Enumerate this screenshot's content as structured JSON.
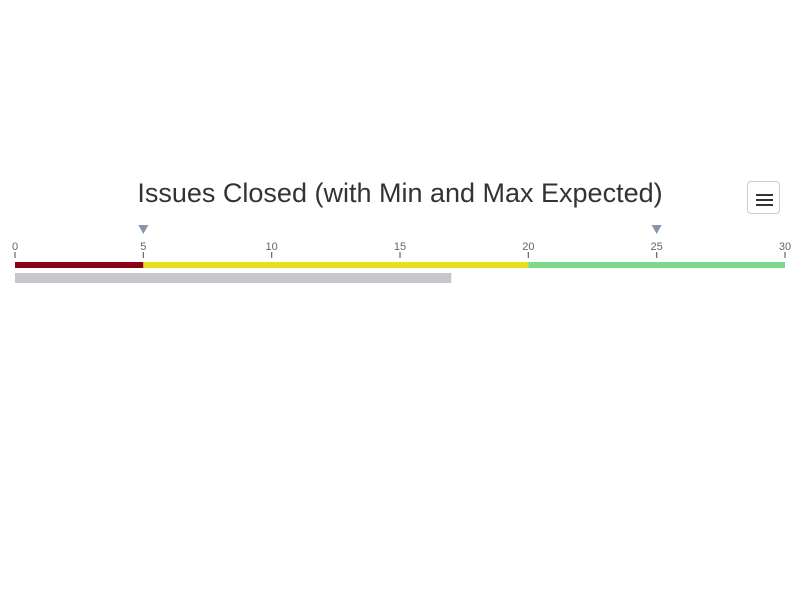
{
  "chart_data": {
    "type": "bullet",
    "title": "Issues Closed (with Min and Max Expected)",
    "axis": {
      "min": 0,
      "max": 30,
      "ticks": [
        0,
        5,
        10,
        15,
        20,
        25,
        30
      ]
    },
    "ranges": [
      {
        "from": 0,
        "to": 5,
        "color": "#8b0016"
      },
      {
        "from": 5,
        "to": 20,
        "color": "#e6e01a"
      },
      {
        "from": 20,
        "to": 30,
        "color": "#7ed88b"
      }
    ],
    "value": 17,
    "value_color": "#c8c6cc",
    "markers": [
      {
        "value": 5,
        "color": "#8796a8"
      },
      {
        "value": 25,
        "color": "#8796a8"
      }
    ],
    "grid": false,
    "legend": false
  },
  "toolbar": {
    "menu_icon": "hamburger-icon"
  }
}
